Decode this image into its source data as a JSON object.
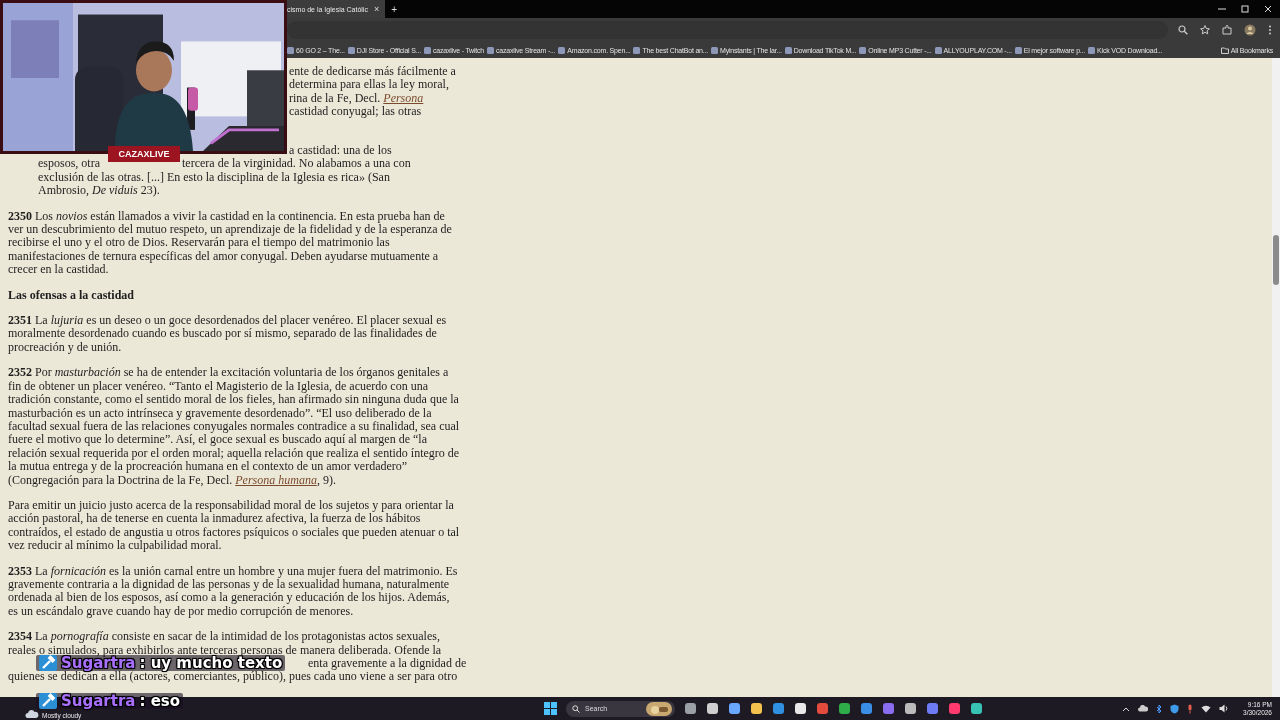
{
  "browser": {
    "tabs": [
      {
        "title": "cismo de la Iglesia Católic",
        "close": "×",
        "selected": true
      }
    ],
    "new_tab": "+",
    "bookmarks": [
      "60 GO 2 – The...",
      "DJI Store - Official S...",
      "cazaxlive - Twitch",
      "cazaxlive Stream -...",
      "Amazon.com. Spen...",
      "The best ChatBot an...",
      "Myinstants | The lar...",
      "Download TikTok M...",
      "Online MP3 Cutter -...",
      "ALLYOUPLAY.COM -...",
      "El mejor software p...",
      "Kick VOD Download..."
    ],
    "all_bookmarks": "All Bookmarks"
  },
  "stream_overlay": {
    "badge": "CAZAXLIVE"
  },
  "document": {
    "blocks": [
      {
        "kind": "lines",
        "lines": [
          {
            "kind": "tail",
            "parts": [
              {
                "kind": "text",
                "text": "ente de dedicarse más fácilmente a"
              }
            ]
          },
          {
            "kind": "tail",
            "parts": [
              {
                "kind": "text",
                "text": "determina para ellas la ley moral,"
              }
            ]
          },
          {
            "kind": "tail",
            "parts": [
              {
                "kind": "text",
                "text": "rina de la Fe, Decl. "
              },
              {
                "kind": "link",
                "text": "Persona"
              }
            ]
          },
          {
            "kind": "tail",
            "parts": [
              {
                "kind": "text",
                "text": "castidad conyugal; las otras"
              }
            ]
          }
        ]
      },
      {
        "kind": "lines",
        "lines": [
          {
            "kind": "tail",
            "parts": [
              {
                "kind": "text",
                "text": "a castidad: una de los"
              }
            ]
          },
          {
            "kind": "split",
            "parts": [
              {
                "kind": "text",
                "text": "esposos, otra"
              },
              {
                "kind": "text",
                "text": "tercera de la virginidad. No alabamos a una con"
              }
            ]
          },
          {
            "kind": "quote",
            "parts": [
              {
                "kind": "text",
                "text": "exclusión de las otras. [...] En esto la disciplina de la Iglesia es rica» (San"
              }
            ]
          },
          {
            "kind": "quote",
            "parts": [
              {
                "kind": "text",
                "text": "Ambrosio, *De viduis* 23)."
              }
            ]
          }
        ]
      },
      {
        "kind": "paragraph",
        "parts": [
          {
            "kind": "text",
            "text": "**2350** Los *novios* están llamados a vivir la castidad en la continencia. En esta prueba han de ver un descubrimiento del mutuo respeto, un aprendizaje de la fidelidad y de la esperanza de recibirse el uno y el otro de Dios. Reservarán para el tiempo del matrimonio las manifestaciones de ternura específicas del amor conyugal. Deben ayudarse mutuamente a crecer en la castidad."
          }
        ]
      },
      {
        "kind": "heading",
        "parts": [
          {
            "kind": "text",
            "text": "Las ofensas a la castidad"
          }
        ]
      },
      {
        "kind": "paragraph",
        "parts": [
          {
            "kind": "text",
            "text": "**2351** La *lujuria* es un deseo o un goce desordenados del placer venéreo. El placer sexual es moralmente desordenado cuando es buscado por sí mismo, separado de las finalidades de procreación y de unión."
          }
        ]
      },
      {
        "kind": "paragraph",
        "parts": [
          {
            "kind": "text",
            "text": "**2352** Por *masturbación* se ha de entender la excitación voluntaria de los órganos genitales a fin de obtener un placer venéreo. “Tanto el Magisterio de la Iglesia, de acuerdo con una tradición constante, como el sentido moral de los fieles, han afirmado sin ninguna duda que la masturbación es un acto intrínseca y gravemente desordenado”. “El uso deliberado de la facultad sexual fuera de las relaciones conyugales normales contradice a su finalidad, sea cual fuere el motivo que lo determine”. Así, el goce sexual es buscado aquí al margen de “la relación sexual requerida por el orden moral; aquella relación que realiza el sentido íntegro de la mutua entrega y de la procreación humana en el contexto de un amor verdadero” (Congregación para la Doctrina de la Fe, Decl. "
          },
          {
            "kind": "link",
            "text": "Persona humana"
          },
          {
            "kind": "text",
            "text": ", 9)."
          }
        ]
      },
      {
        "kind": "paragraph",
        "parts": [
          {
            "kind": "text",
            "text": "Para emitir un juicio justo acerca de la responsabilidad moral de los sujetos y para orientar la acción pastoral, ha de tenerse en cuenta la inmadurez afectiva, la fuerza de los hábitos contraídos, el estado de angustia u otros factores psíquicos o sociales que pueden atenuar o tal vez reducir al mínimo la culpabilidad moral."
          }
        ]
      },
      {
        "kind": "paragraph",
        "parts": [
          {
            "kind": "text",
            "text": "**2353** La *fornicación* es la unión carnal entre un hombre y una mujer fuera del matrimonio. Es gravemente contraria a la dignidad de las personas y de la sexualidad humana, naturalmente ordenada al bien de los esposos, así como a la generación y educación de los hijos. Además, es un escándalo grave cuando hay de por medio corrupción de menores."
          }
        ]
      },
      {
        "kind": "lines",
        "lines": [
          {
            "kind": "full",
            "parts": [
              {
                "kind": "text",
                "text": "**2354** La *pornografía* consiste en sacar de la intimidad de los protagonistas actos sexuales,"
              }
            ]
          },
          {
            "kind": "full",
            "parts": [
              {
                "kind": "text",
                "text": "reales o simulados, para exhibirlos ante terceras personas de manera deliberada. Ofende la"
              }
            ]
          },
          {
            "kind": "end",
            "parts": [
              {
                "kind": "text",
                "text": "enta gravemente a la dignidad de"
              }
            ]
          },
          {
            "kind": "full",
            "parts": [
              {
                "kind": "text",
                "text": "quienes se dedican a ella (actores, comerciantes, público), pues cada uno viene a ser para otro"
              }
            ]
          }
        ]
      }
    ]
  },
  "chat": [
    {
      "user": "Sugartra",
      "message": ": uy mucho texto"
    },
    {
      "user": "Sugartra",
      "message": ": eso"
    }
  ],
  "taskbar": {
    "weather": "Mostly cloudy",
    "search_placeholder": "Search",
    "time": "9:16 PM",
    "date": "3/30/2026"
  }
}
